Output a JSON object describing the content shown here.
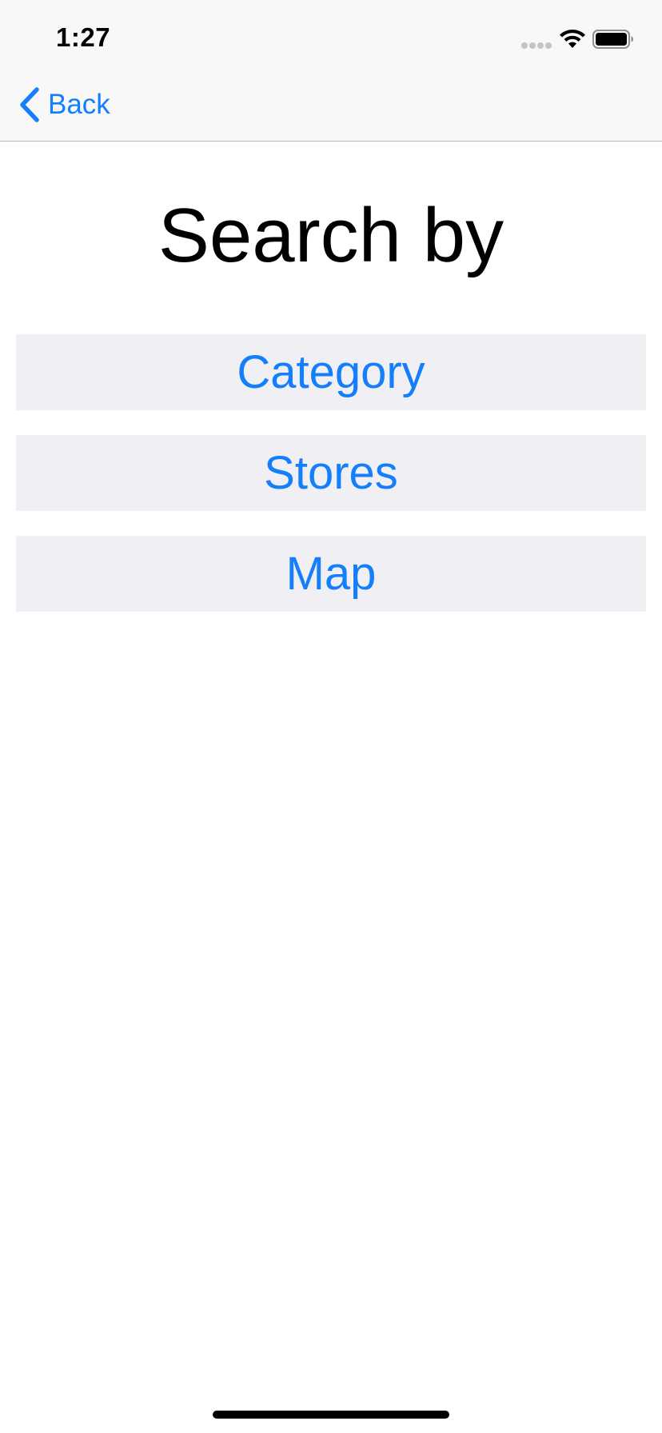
{
  "status_bar": {
    "time": "1:27",
    "icons": [
      "signal-dots-icon",
      "wifi-icon",
      "battery-icon"
    ]
  },
  "nav": {
    "back_label": "Back",
    "back_icon": "chevron-left-icon"
  },
  "main": {
    "title": "Search by",
    "options": [
      {
        "label": "Category"
      },
      {
        "label": "Stores"
      },
      {
        "label": "Map"
      }
    ]
  },
  "colors": {
    "accent": "#147efb",
    "button_background": "#efeff4",
    "nav_background": "#f8f8f8",
    "text": "#000000"
  }
}
